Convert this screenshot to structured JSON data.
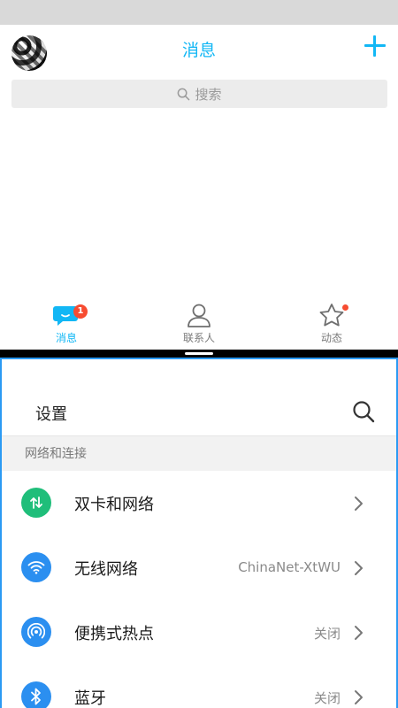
{
  "qq": {
    "title": "消息",
    "search_placeholder": "搜索",
    "accent_color": "#12b7f5",
    "tabs": [
      {
        "label": "消息",
        "icon": "chat-bubble-icon",
        "badge": "1",
        "active": true
      },
      {
        "label": "联系人",
        "icon": "person-icon",
        "active": false
      },
      {
        "label": "动态",
        "icon": "star-icon",
        "dot": true,
        "active": false
      }
    ]
  },
  "settings": {
    "title": "设置",
    "section": "网络和连接",
    "items": [
      {
        "label": "双卡和网络",
        "value": "",
        "icon": "dual-sim-icon",
        "color": "#1fbe7a"
      },
      {
        "label": "无线网络",
        "value": "ChinaNet-XtWU",
        "icon": "wifi-icon",
        "color": "#2b8ff0"
      },
      {
        "label": "便携式热点",
        "value": "关闭",
        "icon": "hotspot-icon",
        "color": "#2b8ff0"
      },
      {
        "label": "蓝牙",
        "value": "关闭",
        "icon": "bluetooth-icon",
        "color": "#2b8ff0"
      }
    ]
  }
}
